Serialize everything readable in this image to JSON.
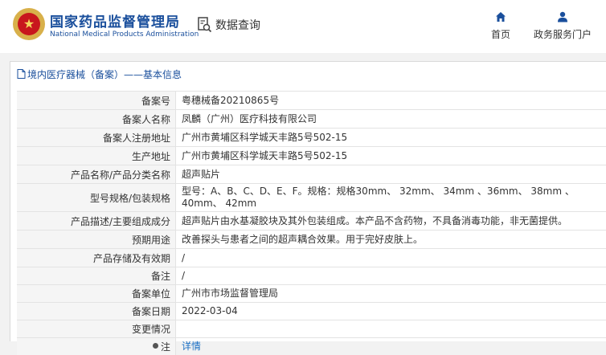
{
  "header": {
    "title_cn": "国家药品监督管理局",
    "title_en": "National Medical Products Administration",
    "query_label": "数据查询",
    "nav": [
      {
        "label": "首页",
        "icon": "home-icon"
      },
      {
        "label": "政务服务门户",
        "icon": "user-icon"
      }
    ]
  },
  "breadcrumb": "境内医疗器械（备案）——基本信息",
  "rows": [
    {
      "label": "备案号",
      "value": "粤穗械备20210865号"
    },
    {
      "label": "备案人名称",
      "value": "凤麟（广州）医疗科技有限公司"
    },
    {
      "label": "备案人注册地址",
      "value": "广州市黄埔区科学城天丰路5号502-15"
    },
    {
      "label": "生产地址",
      "value": "广州市黄埔区科学城天丰路5号502-15"
    },
    {
      "label": "产品名称/产品分类名称",
      "value": "超声贴片"
    },
    {
      "label": "型号规格/包装规格",
      "value": "型号：A、B、C、D、E、F。规格：规格30mm、 32mm、 34mm 、36mm、 38mm 、40mm、 42mm"
    },
    {
      "label": "产品描述/主要组成成分",
      "value": "超声贴片由水基凝胶块及其外包装组成。本产品不含药物，不具备消毒功能，非无菌提供。"
    },
    {
      "label": "预期用途",
      "value": "改善探头与患者之间的超声耦合效果。用于完好皮肤上。"
    },
    {
      "label": "产品存储及有效期",
      "value": "/"
    },
    {
      "label": "备注",
      "value": "/"
    },
    {
      "label": "备案单位",
      "value": "广州市市场监督管理局"
    },
    {
      "label": "备案日期",
      "value": "2022-03-04"
    },
    {
      "label": "变更情况",
      "value": ""
    },
    {
      "label": "注",
      "value": "详情"
    }
  ],
  "colors": {
    "brand_blue": "#1a4f9c",
    "link_blue": "#1a6fc4"
  }
}
